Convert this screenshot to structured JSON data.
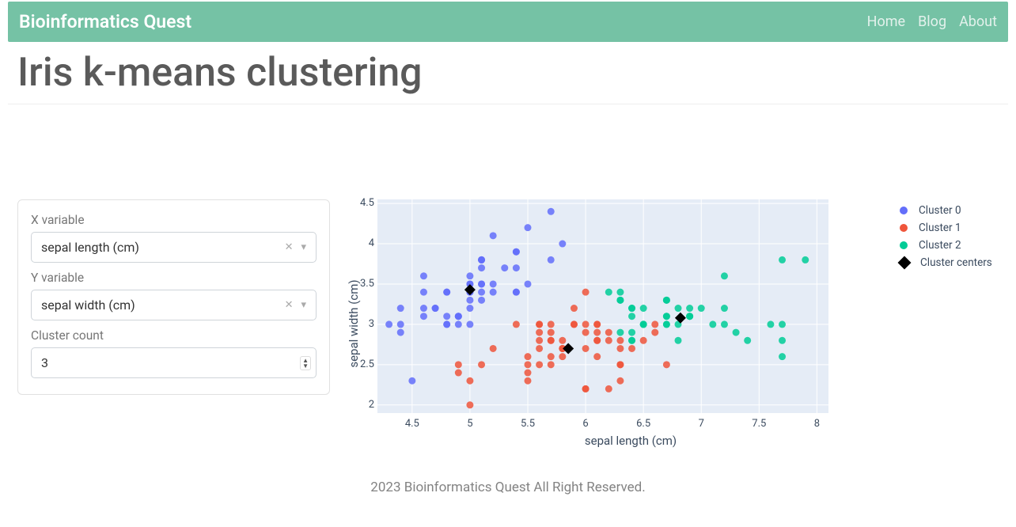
{
  "navbar": {
    "brand": "Bioinformatics Quest",
    "links": [
      "Home",
      "Blog",
      "About"
    ]
  },
  "page_title": "Iris k-means clustering",
  "controls": {
    "x_label": "X variable",
    "x_value": "sepal length (cm)",
    "y_label": "Y variable",
    "y_value": "sepal width (cm)",
    "cluster_label": "Cluster count",
    "cluster_value": "3"
  },
  "legend": {
    "items": [
      {
        "label": "Cluster 0",
        "color": "#636efa"
      },
      {
        "label": "Cluster 1",
        "color": "#ef553b"
      },
      {
        "label": "Cluster 2",
        "color": "#00cc96"
      }
    ],
    "centers_label": "Cluster centers"
  },
  "footer": "2023 Bioinformatics Quest All Right Reserved.",
  "chart_data": {
    "type": "scatter",
    "xlabel": "sepal length (cm)",
    "ylabel": "sepal width (cm)",
    "xlim": [
      4.2,
      8.1
    ],
    "ylim": [
      1.9,
      4.55
    ],
    "xticks": [
      4.5,
      5,
      5.5,
      6,
      6.5,
      7,
      7.5,
      8
    ],
    "yticks": [
      2,
      2.5,
      3,
      3.5,
      4,
      4.5
    ],
    "series": [
      {
        "name": "Cluster 0",
        "color": "#636efa",
        "points": [
          [
            4.3,
            3.0
          ],
          [
            4.4,
            2.9
          ],
          [
            4.4,
            3.0
          ],
          [
            4.4,
            3.2
          ],
          [
            4.5,
            2.3
          ],
          [
            4.6,
            3.1
          ],
          [
            4.6,
            3.2
          ],
          [
            4.6,
            3.4
          ],
          [
            4.6,
            3.6
          ],
          [
            4.7,
            3.2
          ],
          [
            4.7,
            3.2
          ],
          [
            4.8,
            3.0
          ],
          [
            4.8,
            3.0
          ],
          [
            4.8,
            3.1
          ],
          [
            4.8,
            3.4
          ],
          [
            4.8,
            3.4
          ],
          [
            4.9,
            3.0
          ],
          [
            4.9,
            3.1
          ],
          [
            4.9,
            3.1
          ],
          [
            4.9,
            3.1
          ],
          [
            5.0,
            3.0
          ],
          [
            5.0,
            3.2
          ],
          [
            5.0,
            3.3
          ],
          [
            5.0,
            3.4
          ],
          [
            5.0,
            3.4
          ],
          [
            5.0,
            3.5
          ],
          [
            5.0,
            3.5
          ],
          [
            5.0,
            3.6
          ],
          [
            5.1,
            3.3
          ],
          [
            5.1,
            3.4
          ],
          [
            5.1,
            3.5
          ],
          [
            5.1,
            3.5
          ],
          [
            5.1,
            3.7
          ],
          [
            5.1,
            3.8
          ],
          [
            5.1,
            3.8
          ],
          [
            5.1,
            3.8
          ],
          [
            5.2,
            3.4
          ],
          [
            5.2,
            3.5
          ],
          [
            5.2,
            4.1
          ],
          [
            5.3,
            3.7
          ],
          [
            5.4,
            3.4
          ],
          [
            5.4,
            3.4
          ],
          [
            5.4,
            3.7
          ],
          [
            5.4,
            3.9
          ],
          [
            5.4,
            3.9
          ],
          [
            5.5,
            3.5
          ],
          [
            5.5,
            4.2
          ],
          [
            5.7,
            3.8
          ],
          [
            5.7,
            4.4
          ],
          [
            5.8,
            4.0
          ]
        ]
      },
      {
        "name": "Cluster 1",
        "color": "#ef553b",
        "points": [
          [
            4.9,
            2.4
          ],
          [
            4.9,
            2.5
          ],
          [
            5.0,
            2.0
          ],
          [
            5.0,
            2.3
          ],
          [
            5.1,
            2.5
          ],
          [
            5.2,
            2.7
          ],
          [
            5.4,
            3.0
          ],
          [
            5.5,
            2.3
          ],
          [
            5.5,
            2.4
          ],
          [
            5.5,
            2.5
          ],
          [
            5.5,
            2.6
          ],
          [
            5.6,
            2.5
          ],
          [
            5.6,
            2.7
          ],
          [
            5.6,
            2.8
          ],
          [
            5.6,
            2.9
          ],
          [
            5.6,
            3.0
          ],
          [
            5.6,
            3.0
          ],
          [
            5.7,
            2.5
          ],
          [
            5.7,
            2.6
          ],
          [
            5.7,
            2.8
          ],
          [
            5.7,
            2.8
          ],
          [
            5.7,
            2.9
          ],
          [
            5.7,
            3.0
          ],
          [
            5.8,
            2.6
          ],
          [
            5.8,
            2.7
          ],
          [
            5.8,
            2.7
          ],
          [
            5.8,
            2.7
          ],
          [
            5.8,
            2.8
          ],
          [
            5.9,
            3.0
          ],
          [
            5.9,
            3.0
          ],
          [
            5.9,
            3.2
          ],
          [
            6.0,
            2.2
          ],
          [
            6.0,
            2.2
          ],
          [
            6.0,
            2.7
          ],
          [
            6.0,
            2.9
          ],
          [
            6.0,
            3.0
          ],
          [
            6.0,
            3.4
          ],
          [
            6.1,
            2.6
          ],
          [
            6.1,
            2.8
          ],
          [
            6.1,
            2.8
          ],
          [
            6.1,
            2.9
          ],
          [
            6.1,
            3.0
          ],
          [
            6.1,
            3.0
          ],
          [
            6.2,
            2.2
          ],
          [
            6.2,
            2.8
          ],
          [
            6.2,
            2.9
          ],
          [
            6.3,
            2.3
          ],
          [
            6.3,
            2.5
          ],
          [
            6.3,
            2.5
          ],
          [
            6.3,
            2.7
          ],
          [
            6.3,
            2.8
          ],
          [
            6.4,
            2.7
          ],
          [
            6.5,
            2.8
          ],
          [
            6.6,
            2.9
          ],
          [
            6.6,
            3.0
          ],
          [
            6.7,
            2.5
          ]
        ]
      },
      {
        "name": "Cluster 2",
        "color": "#00cc96",
        "points": [
          [
            6.2,
            3.4
          ],
          [
            6.3,
            2.9
          ],
          [
            6.3,
            3.3
          ],
          [
            6.3,
            3.3
          ],
          [
            6.3,
            3.4
          ],
          [
            6.4,
            2.8
          ],
          [
            6.4,
            2.8
          ],
          [
            6.4,
            2.9
          ],
          [
            6.4,
            3.1
          ],
          [
            6.4,
            3.2
          ],
          [
            6.4,
            3.2
          ],
          [
            6.5,
            3.0
          ],
          [
            6.5,
            3.0
          ],
          [
            6.5,
            3.0
          ],
          [
            6.5,
            3.2
          ],
          [
            6.7,
            3.0
          ],
          [
            6.7,
            3.0
          ],
          [
            6.7,
            3.1
          ],
          [
            6.7,
            3.1
          ],
          [
            6.7,
            3.3
          ],
          [
            6.7,
            3.3
          ],
          [
            6.8,
            2.8
          ],
          [
            6.8,
            3.0
          ],
          [
            6.8,
            3.2
          ],
          [
            6.9,
            3.1
          ],
          [
            6.9,
            3.1
          ],
          [
            6.9,
            3.1
          ],
          [
            6.9,
            3.2
          ],
          [
            7.0,
            3.2
          ],
          [
            7.1,
            3.0
          ],
          [
            7.2,
            3.0
          ],
          [
            7.2,
            3.2
          ],
          [
            7.2,
            3.6
          ],
          [
            7.3,
            2.9
          ],
          [
            7.4,
            2.8
          ],
          [
            7.6,
            3.0
          ],
          [
            7.7,
            2.6
          ],
          [
            7.7,
            2.8
          ],
          [
            7.7,
            3.0
          ],
          [
            7.7,
            3.8
          ],
          [
            7.9,
            3.8
          ]
        ]
      }
    ],
    "centers": [
      {
        "x": 5.0,
        "y": 3.43
      },
      {
        "x": 5.85,
        "y": 2.7
      },
      {
        "x": 6.82,
        "y": 3.08
      }
    ]
  }
}
